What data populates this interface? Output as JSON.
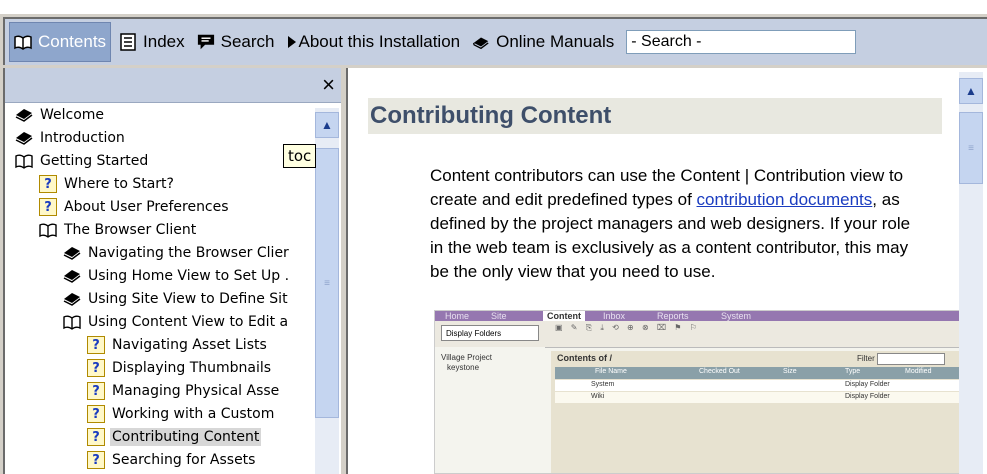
{
  "toolbar": {
    "contents": "Contents",
    "index": "Index",
    "search": "Search",
    "about": "About this Installation",
    "manuals": "Online Manuals",
    "search_box": "- Search -"
  },
  "left_pane": {
    "close": "×",
    "tooltip": "toc",
    "tree": [
      {
        "label": "Welcome",
        "icon": "book-stack-icon"
      },
      {
        "label": "Introduction",
        "icon": "book-stack-icon"
      },
      {
        "label": "Getting Started",
        "icon": "open-book-icon"
      },
      {
        "label": "Where to Start?",
        "icon": "help-page-icon"
      },
      {
        "label": "About User Preferences",
        "icon": "help-page-icon"
      },
      {
        "label": "The Browser Client",
        "icon": "open-book-icon"
      },
      {
        "label": "Navigating the Browser Clier",
        "icon": "book-stack-icon"
      },
      {
        "label": "Using Home View to Set Up .",
        "icon": "book-stack-icon"
      },
      {
        "label": "Using Site View to Define Sit",
        "icon": "book-stack-icon"
      },
      {
        "label": "Using Content View to Edit a",
        "icon": "open-book-icon"
      },
      {
        "label": "Navigating Asset Lists",
        "icon": "help-page-icon"
      },
      {
        "label": "Displaying Thumbnails",
        "icon": "help-page-icon"
      },
      {
        "label": "Managing Physical Asse",
        "icon": "help-page-icon"
      },
      {
        "label": "Working with a Custom",
        "icon": "help-page-icon"
      },
      {
        "label": "Contributing Content",
        "icon": "help-page-icon"
      },
      {
        "label": "Searching for Assets",
        "icon": "help-page-icon"
      }
    ]
  },
  "article": {
    "title": "Contributing Content",
    "p1": "Content contributors can use the Content | Contribution view to create and edit predefined types of ",
    "link": "contribution documents",
    "p2": ", as defined by the project managers and web designers. If your role in the web team is exclusively as a content contributor, this may be the only view that you need to use."
  },
  "embedded": {
    "tabs": [
      "Home",
      "Site",
      "Content",
      "Inbox",
      "Reports",
      "System"
    ],
    "active_tab": "Content",
    "dropdown": "Display Folders",
    "tree": [
      "Village Project",
      "keystone"
    ],
    "crumb": "Contents of /",
    "filter_label": "Filter",
    "columns": [
      "File Name",
      "Checked Out",
      "Size",
      "Type",
      "Modified"
    ],
    "rows": [
      {
        "name": "System",
        "type": "Display Folder"
      },
      {
        "name": "Wiki",
        "type": "Display Folder"
      }
    ]
  }
}
